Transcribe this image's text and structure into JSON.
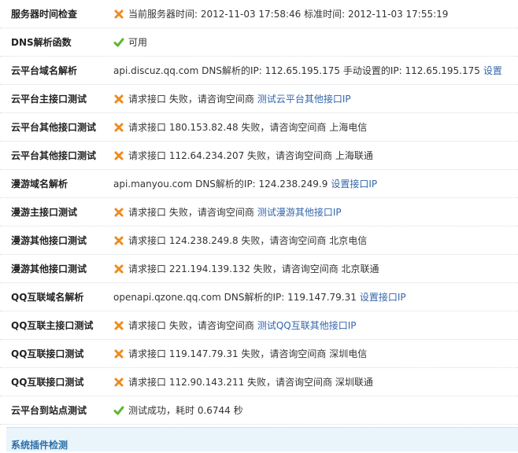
{
  "rows": [
    {
      "label": "服务器时间检查",
      "icon": "cross-icon",
      "text": "当前服务器时间: 2012-11-03 17:58:46 标准时间: 2012-11-03 17:55:19"
    },
    {
      "label": "DNS解析函数",
      "icon": "check-icon",
      "text": "可用"
    },
    {
      "label": "云平台域名解析",
      "icon": "",
      "text": "api.discuz.qq.com DNS解析的IP: 112.65.195.175 手动设置的IP: 112.65.195.175",
      "link": "设置"
    },
    {
      "label": "云平台主接口测试",
      "icon": "cross-icon",
      "text": "请求接口 失败，请咨询空间商",
      "link": "测试云平台其他接口IP"
    },
    {
      "label": "云平台其他接口测试",
      "icon": "cross-icon",
      "text": "请求接口 180.153.82.48 失败，请咨询空间商 上海电信"
    },
    {
      "label": "云平台其他接口测试",
      "icon": "cross-icon",
      "text": "请求接口 112.64.234.207 失败，请咨询空间商 上海联通"
    },
    {
      "label": "漫游域名解析",
      "icon": "",
      "text": "api.manyou.com DNS解析的IP: 124.238.249.9",
      "link": "设置接口IP"
    },
    {
      "label": "漫游主接口测试",
      "icon": "cross-icon",
      "text": "请求接口 失败，请咨询空间商",
      "link": "测试漫游其他接口IP"
    },
    {
      "label": "漫游其他接口测试",
      "icon": "cross-icon",
      "text": "请求接口 124.238.249.8 失败，请咨询空间商 北京电信"
    },
    {
      "label": "漫游其他接口测试",
      "icon": "cross-icon",
      "text": "请求接口 221.194.139.132 失败，请咨询空间商 北京联通"
    },
    {
      "label": "QQ互联域名解析",
      "icon": "",
      "text": "openapi.qzone.qq.com DNS解析的IP: 119.147.79.31",
      "link": "设置接口IP"
    },
    {
      "label": "QQ互联主接口测试",
      "icon": "cross-icon",
      "text": "请求接口 失败，请咨询空间商",
      "link": "测试QQ互联其他接口IP"
    },
    {
      "label": "QQ互联接口测试",
      "icon": "cross-icon",
      "text": "请求接口 119.147.79.31 失败，请咨询空间商 深圳电信"
    },
    {
      "label": "QQ互联接口测试",
      "icon": "cross-icon",
      "text": "请求接口 112.90.143.211 失败，请咨询空间商 深圳联通"
    },
    {
      "label": "云平台到站点测试",
      "icon": "check-icon",
      "text": "测试成功，耗时 0.6744 秒"
    }
  ],
  "section": {
    "title": "系统插件检测"
  },
  "colors": {
    "cross": "#f08a1c",
    "check": "#5cb82a",
    "link": "#3366aa"
  }
}
